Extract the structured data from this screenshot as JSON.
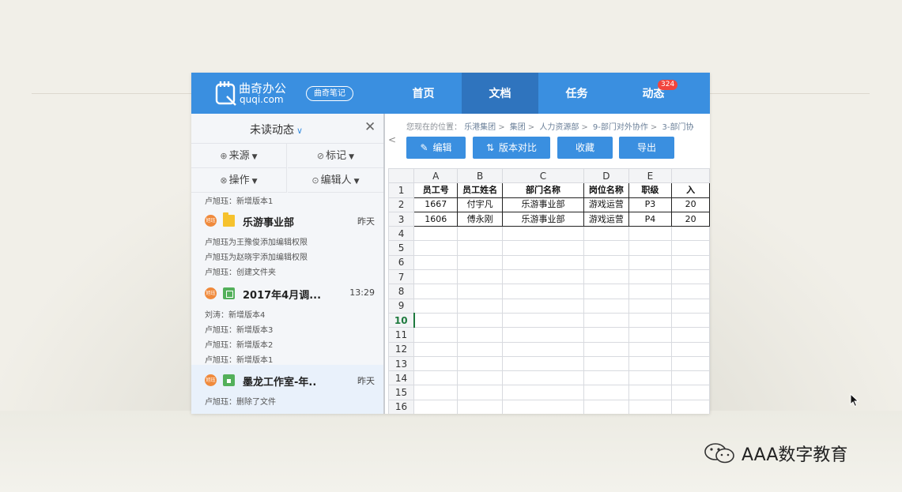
{
  "header": {
    "logo_cn": "曲奇办公",
    "logo_en": "quqi.com",
    "notes_label": "曲奇笔记",
    "tabs": [
      {
        "label": "首页",
        "active": false
      },
      {
        "label": "文档",
        "active": true
      },
      {
        "label": "任务",
        "active": false
      },
      {
        "label": "动态",
        "active": false,
        "badge": "324"
      }
    ],
    "color": "#3a8fe0"
  },
  "sidebar": {
    "title": "未读动态",
    "filters": {
      "source": "来源",
      "mark": "标记",
      "operation": "操作",
      "editor": "编辑人"
    },
    "top_line": "卢旭珏：新增版本1",
    "groups": [
      {
        "name": "乐游事业部",
        "time": "昨天",
        "avatar": "旭珏",
        "icon": "folder-icon",
        "lines": [
          "卢旭珏为王豫俊添加编辑权限",
          "卢旭珏为赵晓宇添加编辑权限",
          "卢旭珏：创建文件夹"
        ]
      },
      {
        "name": "2017年4月调...",
        "time": "13:29",
        "avatar": "旭珏",
        "icon": "spreadsheet-icon",
        "lines": [
          "刘涛：新增版本4",
          "卢旭珏：新增版本3",
          "卢旭珏：新增版本2",
          "卢旭珏：新增版本1"
        ]
      },
      {
        "name": "墨龙工作室-年..",
        "time": "昨天",
        "avatar": "旭珏",
        "icon": "locked-file-icon",
        "lines": [
          "卢旭珏：删除了文件"
        ]
      }
    ]
  },
  "main": {
    "breadcrumb_prefix": "您现在的位置：",
    "breadcrumb": [
      "乐港集团",
      "集团",
      "人力资源部",
      "9-部门对外协作",
      "3-部门协"
    ],
    "buttons": {
      "edit": "编辑",
      "compare": "版本对比",
      "favorite": "收藏",
      "export": "导出"
    },
    "sheet": {
      "columns": [
        "A",
        "B",
        "C",
        "D",
        "E",
        ""
      ],
      "rows": [
        "1",
        "2",
        "3",
        "4",
        "5",
        "6",
        "7",
        "8",
        "9",
        "10",
        "11",
        "12",
        "13",
        "14",
        "15",
        "16"
      ],
      "selected_row": "10",
      "header_row": [
        "员工号",
        "员工姓名",
        "部门名称",
        "岗位名称",
        "职级",
        "入"
      ],
      "data_rows": [
        [
          "1667",
          "付宇凡",
          "乐游事业部",
          "游戏运营",
          "P3",
          "20"
        ],
        [
          "1606",
          "傅永刚",
          "乐游事业部",
          "游戏运营",
          "P4",
          "20"
        ]
      ]
    }
  },
  "watermark": "AAA数字教育"
}
